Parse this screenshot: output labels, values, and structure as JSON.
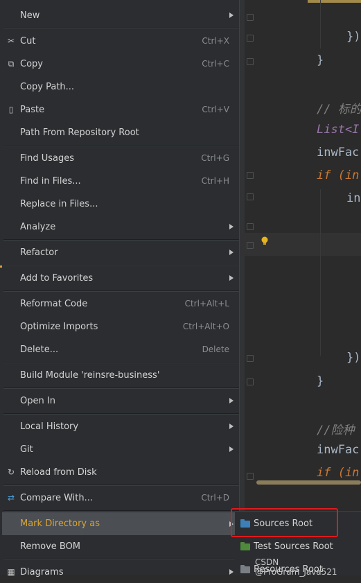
{
  "menu": {
    "items": [
      {
        "label": "New",
        "shortcut": "",
        "submenu": true,
        "icon": ""
      },
      {
        "label": "Cut",
        "shortcut": "Ctrl+X",
        "submenu": false,
        "icon": "scissors-icon"
      },
      {
        "label": "Copy",
        "shortcut": "Ctrl+C",
        "submenu": false,
        "icon": "copy-icon"
      },
      {
        "label": "Copy Path...",
        "shortcut": "",
        "submenu": false,
        "icon": ""
      },
      {
        "label": "Paste",
        "shortcut": "Ctrl+V",
        "submenu": false,
        "icon": "clipboard-icon"
      },
      {
        "label": "Path From Repository Root",
        "shortcut": "",
        "submenu": false,
        "icon": ""
      },
      {
        "label": "Find Usages",
        "shortcut": "Ctrl+G",
        "submenu": false,
        "icon": ""
      },
      {
        "label": "Find in Files...",
        "shortcut": "Ctrl+H",
        "submenu": false,
        "icon": ""
      },
      {
        "label": "Replace in Files...",
        "shortcut": "",
        "submenu": false,
        "icon": ""
      },
      {
        "label": "Analyze",
        "shortcut": "",
        "submenu": true,
        "icon": ""
      },
      {
        "label": "Refactor",
        "shortcut": "",
        "submenu": true,
        "icon": ""
      },
      {
        "label": "Add to Favorites",
        "shortcut": "",
        "submenu": true,
        "icon": ""
      },
      {
        "label": "Reformat Code",
        "shortcut": "Ctrl+Alt+L",
        "submenu": false,
        "icon": ""
      },
      {
        "label": "Optimize Imports",
        "shortcut": "Ctrl+Alt+O",
        "submenu": false,
        "icon": ""
      },
      {
        "label": "Delete...",
        "shortcut": "Delete",
        "submenu": false,
        "icon": ""
      },
      {
        "label": "Build Module 'reinsre-business'",
        "shortcut": "",
        "submenu": false,
        "icon": ""
      },
      {
        "label": "Open In",
        "shortcut": "",
        "submenu": true,
        "icon": ""
      },
      {
        "label": "Local History",
        "shortcut": "",
        "submenu": true,
        "icon": ""
      },
      {
        "label": "Git",
        "shortcut": "",
        "submenu": true,
        "icon": ""
      },
      {
        "label": "Reload from Disk",
        "shortcut": "",
        "submenu": false,
        "icon": "reload-icon"
      },
      {
        "label": "Compare With...",
        "shortcut": "Ctrl+D",
        "submenu": false,
        "icon": "compare-icon"
      },
      {
        "label": "Mark Directory as",
        "shortcut": "",
        "submenu": true,
        "icon": "",
        "selected": true
      },
      {
        "label": "Remove BOM",
        "shortcut": "",
        "submenu": false,
        "icon": ""
      },
      {
        "label": "Diagrams",
        "shortcut": "",
        "submenu": true,
        "icon": "diagram-icon"
      }
    ]
  },
  "submenu": {
    "items": [
      {
        "label": "Sources Root",
        "color": "#3d7fb8"
      },
      {
        "label": "Test Sources Root",
        "color": "#4f8a3c"
      },
      {
        "label": "Resources Root",
        "color": "#7a7f86"
      }
    ]
  },
  "code": {
    "lines": [
      "})",
      "}",
      "// 标的",
      "List<I",
      "inwFac",
      "if (in",
      "in",
      "})",
      "}",
      "//险种",
      "inwFac",
      "if (in"
    ]
  },
  "watermark": "CSDN @ProGram_Java521",
  "colors": {
    "highlight": "#4b4e52",
    "annotation_box": "#e0191d",
    "menu_bg": "#2b2d30"
  }
}
